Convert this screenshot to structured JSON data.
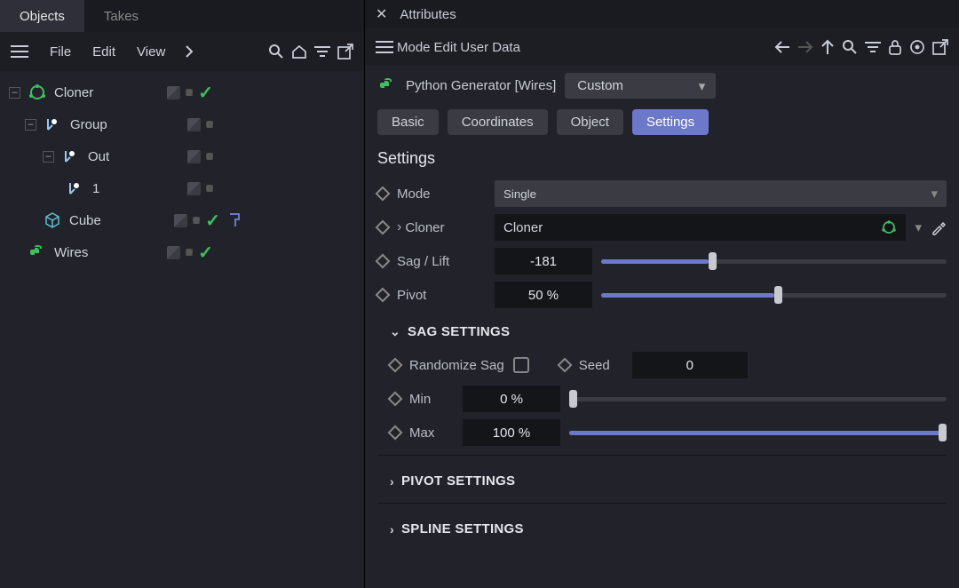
{
  "left": {
    "tabs": {
      "objects": "Objects",
      "takes": "Takes"
    },
    "menus": {
      "file": "File",
      "edit": "Edit",
      "view": "View"
    },
    "tree": {
      "cloner": "Cloner",
      "group": "Group",
      "out": "Out",
      "one": "1",
      "cube": "Cube",
      "wires": "Wires"
    }
  },
  "right": {
    "panel_title": "Attributes",
    "menus": {
      "mode": "Mode",
      "edit": "Edit",
      "userdata": "User Data"
    },
    "object_title": "Python Generator [Wires]",
    "mode_select": "Custom",
    "tabs": {
      "basic": "Basic",
      "coords": "Coordinates",
      "object": "Object",
      "settings": "Settings"
    },
    "section": "Settings",
    "params": {
      "mode_lbl": "Mode",
      "mode_val": "Single",
      "cloner_lbl": "Cloner",
      "cloner_val": "Cloner",
      "sag_lbl": "Sag / Lift",
      "sag_val": "-181",
      "pivot_lbl": "Pivot",
      "pivot_val": "50 %",
      "sag_section": "SAG SETTINGS",
      "rand_lbl": "Randomize Sag",
      "seed_lbl": "Seed",
      "seed_val": "0",
      "min_lbl": "Min",
      "min_val": "0 %",
      "max_lbl": "Max",
      "max_val": "100 %",
      "pivot_section": "PIVOT SETTINGS",
      "spline_section": "SPLINE SETTINGS"
    },
    "sliders": {
      "sag_pct": 31,
      "pivot_pct": 50,
      "min_pct": 0,
      "max_pct": 100
    }
  }
}
